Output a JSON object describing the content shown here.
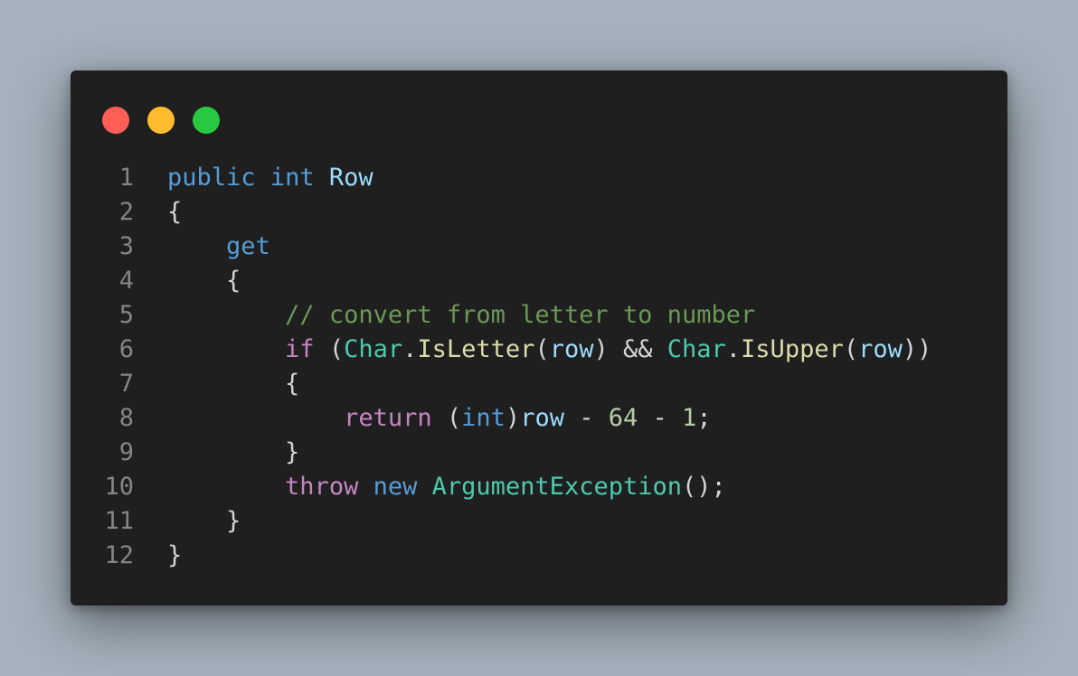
{
  "window": {
    "controls": [
      {
        "name": "close",
        "color": "#ff5f57"
      },
      {
        "name": "minimize",
        "color": "#febc2e"
      },
      {
        "name": "maximize",
        "color": "#28c840"
      }
    ]
  },
  "code": {
    "lines": [
      {
        "n": "1",
        "tokens": [
          {
            "t": "public",
            "c": "kw"
          },
          {
            "t": " ",
            "c": "pun"
          },
          {
            "t": "int",
            "c": "kw"
          },
          {
            "t": " ",
            "c": "pun"
          },
          {
            "t": "Row",
            "c": "var"
          }
        ]
      },
      {
        "n": "2",
        "tokens": [
          {
            "t": "{",
            "c": "pun"
          }
        ]
      },
      {
        "n": "3",
        "tokens": [
          {
            "t": "    ",
            "c": "pun"
          },
          {
            "t": "get",
            "c": "kw"
          }
        ]
      },
      {
        "n": "4",
        "tokens": [
          {
            "t": "    {",
            "c": "pun"
          }
        ]
      },
      {
        "n": "5",
        "tokens": [
          {
            "t": "        ",
            "c": "pun"
          },
          {
            "t": "// convert from letter to number",
            "c": "com"
          }
        ]
      },
      {
        "n": "6",
        "tokens": [
          {
            "t": "        ",
            "c": "pun"
          },
          {
            "t": "if",
            "c": "ctl"
          },
          {
            "t": " (",
            "c": "pun"
          },
          {
            "t": "Char",
            "c": "type"
          },
          {
            "t": ".",
            "c": "pun"
          },
          {
            "t": "IsLetter",
            "c": "fn"
          },
          {
            "t": "(",
            "c": "pun"
          },
          {
            "t": "row",
            "c": "var"
          },
          {
            "t": ") && ",
            "c": "pun"
          },
          {
            "t": "Char",
            "c": "type"
          },
          {
            "t": ".",
            "c": "pun"
          },
          {
            "t": "IsUpper",
            "c": "fn"
          },
          {
            "t": "(",
            "c": "pun"
          },
          {
            "t": "row",
            "c": "var"
          },
          {
            "t": "))",
            "c": "pun"
          }
        ]
      },
      {
        "n": "7",
        "tokens": [
          {
            "t": "        {",
            "c": "pun"
          }
        ]
      },
      {
        "n": "8",
        "tokens": [
          {
            "t": "            ",
            "c": "pun"
          },
          {
            "t": "return",
            "c": "ctl"
          },
          {
            "t": " (",
            "c": "pun"
          },
          {
            "t": "int",
            "c": "kw"
          },
          {
            "t": ")",
            "c": "pun"
          },
          {
            "t": "row",
            "c": "var"
          },
          {
            "t": " - ",
            "c": "pun"
          },
          {
            "t": "64",
            "c": "num"
          },
          {
            "t": " - ",
            "c": "pun"
          },
          {
            "t": "1",
            "c": "num"
          },
          {
            "t": ";",
            "c": "pun"
          }
        ]
      },
      {
        "n": "9",
        "tokens": [
          {
            "t": "        }",
            "c": "pun"
          }
        ]
      },
      {
        "n": "10",
        "tokens": [
          {
            "t": "        ",
            "c": "pun"
          },
          {
            "t": "throw",
            "c": "ctl"
          },
          {
            "t": " ",
            "c": "pun"
          },
          {
            "t": "new",
            "c": "kw"
          },
          {
            "t": " ",
            "c": "pun"
          },
          {
            "t": "ArgumentException",
            "c": "type"
          },
          {
            "t": "();",
            "c": "pun"
          }
        ]
      },
      {
        "n": "11",
        "tokens": [
          {
            "t": "    }",
            "c": "pun"
          }
        ]
      },
      {
        "n": "12",
        "tokens": [
          {
            "t": "}",
            "c": "pun"
          }
        ]
      }
    ]
  }
}
